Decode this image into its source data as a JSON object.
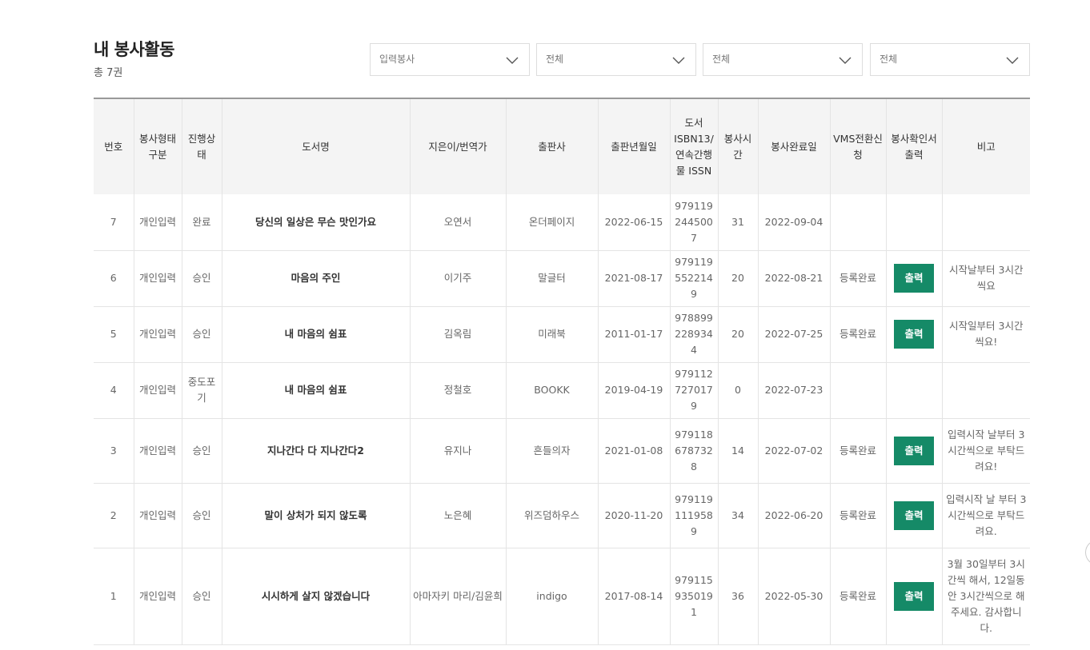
{
  "page": {
    "title": "내 봉사활동",
    "count": "총 7권"
  },
  "filters": [
    {
      "value": "입력봉사",
      "icon": "chevron-down-icon"
    },
    {
      "value": "전체",
      "icon": "chevron-down-icon"
    },
    {
      "value": "전체",
      "icon": "chevron-down-icon"
    },
    {
      "value": "전체",
      "icon": "chevron-down-icon"
    }
  ],
  "table": {
    "headers": [
      "번호",
      "봉사형태구분",
      "진행상태",
      "도서명",
      "지은이/번역가",
      "출판사",
      "출판년월일",
      "도서 ISBN13/연속간행물 ISSN",
      "봉사시간",
      "봉사완료일",
      "VMS전환신청",
      "봉사확인서출력",
      "비고"
    ],
    "print_label": "출력",
    "rows": [
      {
        "no": "7",
        "type": "개인입력",
        "status": "완료",
        "title": "당신의 일상은 무슨 맛인가요",
        "author": "오연서",
        "publisher": "온더페이지",
        "pubdate": "2022-06-15",
        "isbn": "9791192445007",
        "hours": "31",
        "done": "2022-09-04",
        "vms": "",
        "print": false,
        "note": ""
      },
      {
        "no": "6",
        "type": "개인입력",
        "status": "승인",
        "title": "마음의 주인",
        "author": "이기주",
        "publisher": "말글터",
        "pubdate": "2021-08-17",
        "isbn": "9791195522149",
        "hours": "20",
        "done": "2022-08-21",
        "vms": "등록완료",
        "print": true,
        "note": "시작날부터 3시간씩요"
      },
      {
        "no": "5",
        "type": "개인입력",
        "status": "승인",
        "title": "내 마음의 쉼표",
        "author": "김옥림",
        "publisher": "미래북",
        "pubdate": "2011-01-17",
        "isbn": "9788992289344",
        "hours": "20",
        "done": "2022-07-25",
        "vms": "등록완료",
        "print": true,
        "note": "시작일부터 3시간씩요!"
      },
      {
        "no": "4",
        "type": "개인입력",
        "status": "중도포기",
        "title": "내 마음의 쉼표",
        "author": "정철호",
        "publisher": "BOOKK",
        "pubdate": "2019-04-19",
        "isbn": "9791127270179",
        "hours": "0",
        "done": "2022-07-23",
        "vms": "",
        "print": false,
        "note": ""
      },
      {
        "no": "3",
        "type": "개인입력",
        "status": "승인",
        "title": "지나간다 다 지나간다2",
        "author": "유지나",
        "publisher": "흔들의자",
        "pubdate": "2021-01-08",
        "isbn": "9791186787328",
        "hours": "14",
        "done": "2022-07-02",
        "vms": "등록완료",
        "print": true,
        "note": "입력시작 날부터 3시간씩으로 부탁드려요!"
      },
      {
        "no": "2",
        "type": "개인입력",
        "status": "승인",
        "title": "말이 상처가 되지 않도록",
        "author": "노은혜",
        "publisher": "위즈덤하우스",
        "pubdate": "2020-11-20",
        "isbn": "9791191119589",
        "hours": "34",
        "done": "2022-06-20",
        "vms": "등록완료",
        "print": true,
        "note": "입력시작 날 부터 3시간씩으로 부탁드려요."
      },
      {
        "no": "1",
        "type": "개인입력",
        "status": "승인",
        "title": "시시하게 살지 않겠습니다",
        "author": "아마자키 마리/김윤희",
        "publisher": "indigo",
        "pubdate": "2017-08-14",
        "isbn": "9791159350191",
        "hours": "36",
        "done": "2022-05-30",
        "vms": "등록완료",
        "print": true,
        "note": "3월 30일부터 3시간씩 해서, 12일동안 3시간씩으로 해주세요. 감사합니다."
      }
    ]
  }
}
